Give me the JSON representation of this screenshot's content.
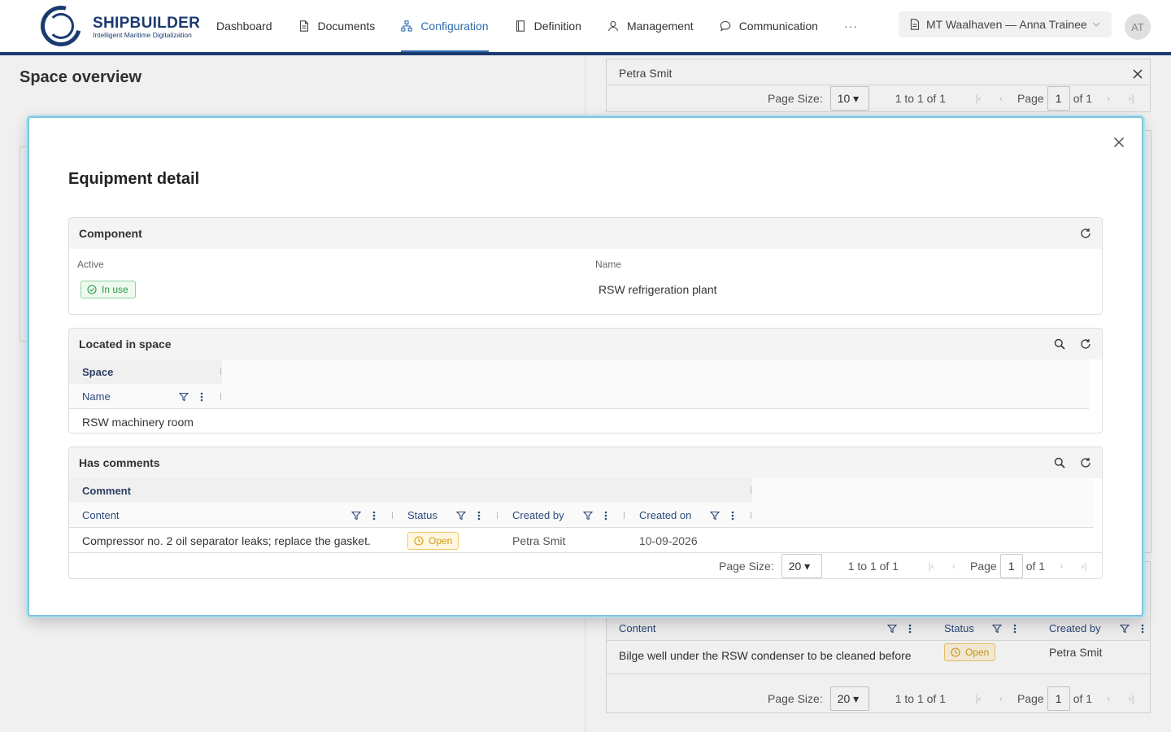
{
  "app": {
    "logo_title": "SHIPBUILDER",
    "logo_subtitle": "Intelligent Maritime Digitalization",
    "nav": [
      {
        "label": "Dashboard",
        "icon": "none"
      },
      {
        "label": "Documents",
        "icon": "document-icon"
      },
      {
        "label": "Configuration",
        "icon": "hierarchy-icon",
        "active": true
      },
      {
        "label": "Definition",
        "icon": "book-icon"
      },
      {
        "label": "Management",
        "icon": "user-icon"
      },
      {
        "label": "Communication",
        "icon": "chat-icon"
      }
    ],
    "nav_more": "···",
    "vessel_label": "MT Waalhaven — Anna Trainee",
    "avatar_initials": "AT",
    "accent_color": "#2f6cb0",
    "brand_color": "#1b3b6f"
  },
  "background": {
    "page_title": "Space overview",
    "top_card_name": "Petra Smit",
    "top_pager": {
      "page_size_label": "Page Size:",
      "page_size": "10",
      "range": "1 to 1 of 1",
      "page_label": "Page",
      "page": "1",
      "of": "of 1"
    },
    "bottom_table": {
      "headers": [
        "Content",
        "Status",
        "Created by"
      ],
      "row_content": "Bilge well under the RSW condenser to be cleaned before the inspection.",
      "row_status": "Open",
      "row_created_by": "Petra Smit"
    },
    "bottom_pager": {
      "page_size_label": "Page Size:",
      "page_size": "20",
      "range": "1 to 1 of 1",
      "page_label": "Page",
      "page": "1",
      "of": "of 1"
    }
  },
  "modal": {
    "title": "Equipment detail",
    "component": {
      "header": "Component",
      "active_label": "Active",
      "active_value": "In use",
      "name_label": "Name",
      "name_value": "RSW refrigeration plant"
    },
    "located": {
      "header": "Located in space",
      "group_header": "Space",
      "column": "Name",
      "rows": [
        "RSW machinery room"
      ]
    },
    "comments": {
      "header": "Has comments",
      "group_header": "Comment",
      "columns": [
        "Content",
        "Status",
        "Created by",
        "Created on"
      ],
      "rows": [
        {
          "content": "Compressor no. 2 oil separator leaks; replace the gasket.",
          "status": "Open",
          "created_by": "Petra Smit",
          "created_on": "10-09-2026"
        }
      ],
      "pager": {
        "page_size_label": "Page Size:",
        "page_size": "20",
        "range": "1 to 1 of 1",
        "page_label": "Page",
        "page": "1",
        "of": "of 1"
      }
    }
  }
}
